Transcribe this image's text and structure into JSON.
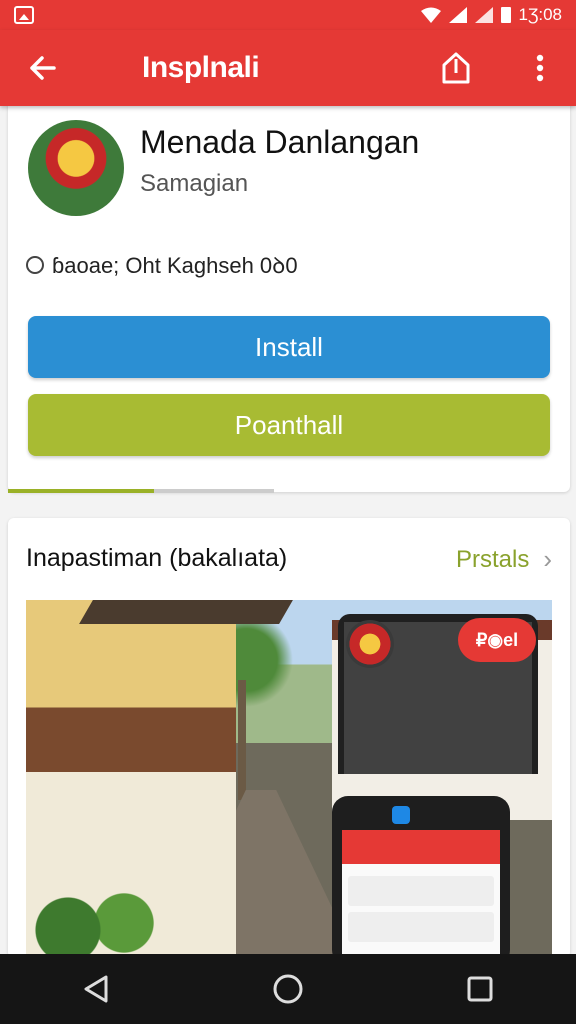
{
  "status_bar": {
    "time": "1Ʒ:08"
  },
  "app_bar": {
    "title": "Insplnali"
  },
  "app": {
    "name": "Menada Danlangan",
    "developer": "Samagian",
    "info_text": "ɓaoae; Oht Kaghseh 0ꝺ0",
    "install_label": "Install",
    "second_button_label": "Poanthall",
    "install_color": "#2b8fd3",
    "second_color": "#a8bb33",
    "progress": 0.55
  },
  "screenshots": {
    "section_title": "Inapastiman (bakalıata)",
    "link_label": "Prstals",
    "overlay_badge": "₽◉el"
  },
  "colors": {
    "accent": "#e53935"
  },
  "icons": [
    "back-arrow-icon",
    "share-icon",
    "more-vert-icon",
    "nav-back-icon",
    "nav-home-icon",
    "nav-recents-icon",
    "chevron-right-icon"
  ]
}
